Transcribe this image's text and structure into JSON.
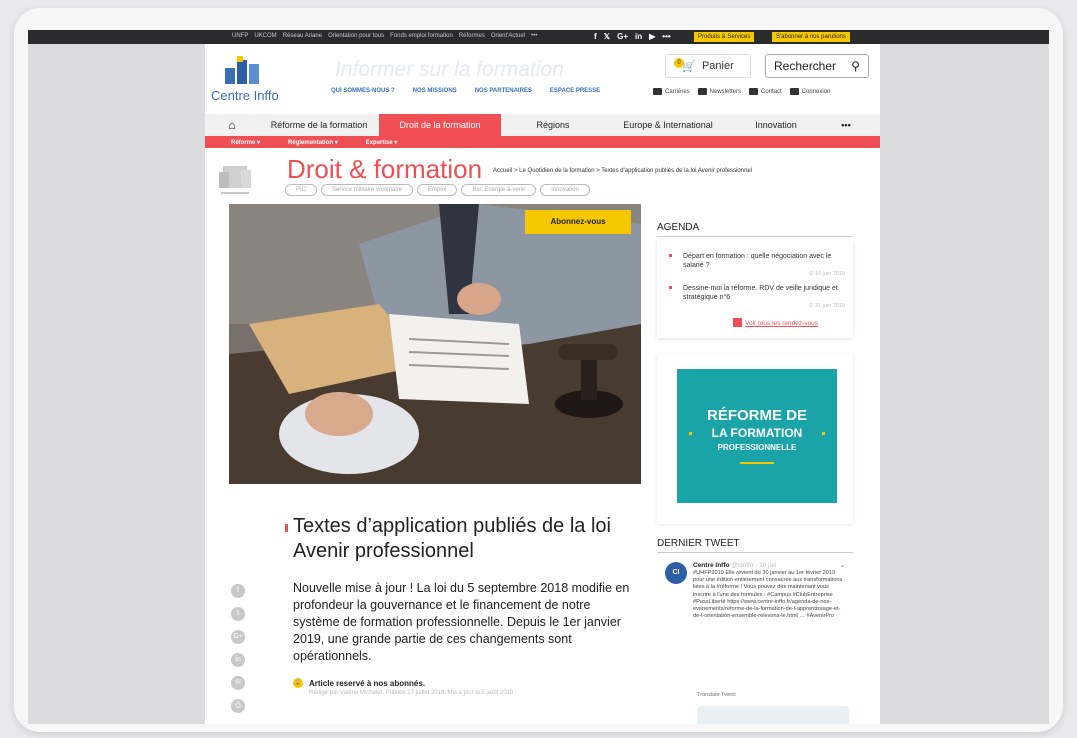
{
  "topbar": {
    "links": [
      "UNFP",
      "UKCOM",
      "Réseau Ariane",
      "Orientation pour tous",
      "Fonds emploi formation",
      "Réformes",
      "Orient'Actuel",
      "•••"
    ],
    "social": [
      "f",
      "𝕏",
      "G+",
      "in",
      "▶",
      "•••"
    ],
    "products_label": "Produits & Services",
    "subscribe_label": "S'abonner à nos parutions"
  },
  "header": {
    "logo_text": "Centre Inffo",
    "tagline": "Informer sur la formation",
    "links": [
      "QUI SOMMES-NOUS ?",
      "NOS MISSIONS",
      "NOS PARTENAIRES",
      "ESPACE PRESSE"
    ],
    "cart_label": "Panier",
    "cart_count": "0",
    "search_label": "Rechercher",
    "utility": [
      "Carrières",
      "Newsletters",
      "Contact",
      "Connexion"
    ]
  },
  "nav": {
    "home_icon": "home-icon",
    "items": [
      "Réforme de la formation",
      "Droit de la formation",
      "Régions",
      "Europe & International",
      "Innovation",
      "•••"
    ],
    "active_index": 1,
    "subnav": [
      "Réforme ▾",
      "Réglementation ▾",
      "Expertise ▾"
    ]
  },
  "section": {
    "title": "Droit & formation",
    "breadcrumb": "Accueil > Le Quotidien de la formation > Textes d'application publiés de la loi Avenir professionnel",
    "tags": [
      "PIC",
      "Service militaire volontaire",
      "Emploi",
      "Bac Energie-à-venir",
      "innovation"
    ]
  },
  "hero": {
    "subscribe_label": "Abonnez-vous"
  },
  "article": {
    "title": "Textes d’application publiés de la loi Avenir professionnel",
    "lead": "Nouvelle mise à jour ! La loi du 5 septembre 2018 modifie en profondeur la gouvernance et le financement de notre système de formation professionnelle. Depuis le 1er janvier 2019, une grande partie de ces changements sont opérationnels.",
    "reserved": "Article reservé à nos abonnés.",
    "author": "Rédigé par Valérie Michelet. Publiée 27 juillet 2018. Mis à jour le 5 août 2019",
    "share_icons": [
      "f",
      "t",
      "G+",
      "in",
      "✉",
      "⎙"
    ]
  },
  "agenda": {
    "title": "AGENDA",
    "items": [
      {
        "text": "Départ en formation : quelle négociation avec le salarié ?",
        "date": "⏲ 19 juin 2019"
      },
      {
        "text": "Dessine-moi la réforme. RDV de veille juridique et stratégique n°6",
        "date": "⏲ 21 juin 2019"
      }
    ],
    "all_label": "Voir tous les rendez-vous"
  },
  "promo": {
    "line1": "RÉFORME DE",
    "line2": "LA FORMATION",
    "line3": "PROFESSIONNELLE"
  },
  "tweet": {
    "title": "DERNIER TWEET",
    "name": "Centre Inffo",
    "meta": "@cinffo · 10 juil",
    "body": "#UHFP2019 Elle revient du 30 janvier au 1er février 2019 pour une édition entièrement consacrée aux transformations liées à la #réforme ! Vous pouvez dès maintenant vous inscrire à l'une des formules : #Campus #ClubEntreprise #PassLiberté https://www.centre-inffo.fr/agenda-de-nos-evenements/reforme-de-la-formation-de-l-apprentissage-et-de-l-orientation-ensemble-relevons-le.html … #AvenirPro",
    "more": "Translate Tweet"
  },
  "colors": {
    "accent": "#ef4f54",
    "yellow": "#f6c800",
    "blue": "#3a6fb5",
    "teal": "#1aa4a8"
  }
}
